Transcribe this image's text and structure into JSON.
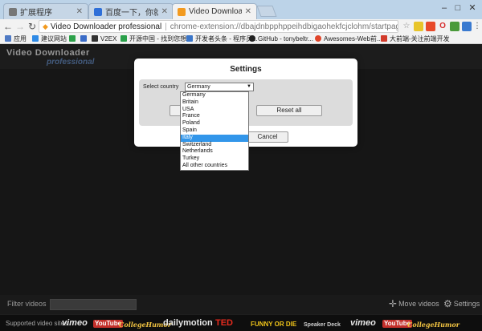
{
  "browser": {
    "tabs": [
      {
        "label": "扩展程序",
        "active": false,
        "icon": "puzzle-icon"
      },
      {
        "label": "百度一下，你就知道",
        "active": false,
        "icon": "baidu-icon"
      },
      {
        "label": "Video Downloader pro",
        "active": true,
        "icon": "video-downloader-icon"
      }
    ],
    "omnibox": {
      "ext_name": "Video Downloader professional",
      "url": "chrome-extension://dbajdnbpphppeihdbigaohekfcjclohm/startpage/index.html?optic"
    },
    "bookmarks": [
      {
        "label": "应用",
        "icon": "apps-icon"
      },
      {
        "label": "建议网站",
        "icon": "ie-icon"
      },
      {
        "label": "",
        "icon": "bookmark-green-icon"
      },
      {
        "label": "",
        "icon": "bookmark-blue-icon"
      },
      {
        "label": "V2EX",
        "icon": "v2ex-icon"
      },
      {
        "label": "开源中国 - 找到您想...",
        "icon": "oschina-icon"
      },
      {
        "label": "开发者头条 - 程序员...",
        "icon": "toutiao-icon"
      },
      {
        "label": "GitHub - tonybeltr...",
        "icon": "github-icon"
      },
      {
        "label": "Awesomes-Web前...",
        "icon": "awesomes-icon"
      },
      {
        "label": "大前端-关注前端开发",
        "icon": "daqianduan-icon"
      }
    ],
    "accent_color": "#3296ea"
  },
  "app": {
    "title_line1": "Video Downloader",
    "title_line2": "professional",
    "filter_label": "Filter videos",
    "filter_value": "",
    "move_videos_label": "Move videos",
    "settings_label": "Settings",
    "supported_label": "Supported video sites:",
    "sites": [
      "vimeo",
      "YouTube",
      "CollegeHumor",
      "dailymotion",
      "TED",
      "FUNNY OR DIE",
      "Speaker Deck",
      "vimeo",
      "YouTube",
      "CollegeHumor"
    ]
  },
  "settings_modal": {
    "title": "Settings",
    "country_label": "Select country",
    "selected_country": "Germany",
    "reset_all_label": "Reset all",
    "cancel_label": "Cancel",
    "country_options": [
      "Germany",
      "Britain",
      "USA",
      "France",
      "Poland",
      "Spain",
      "Italy",
      "Switzerland",
      "Netherlands",
      "Turkey",
      "All other countries"
    ],
    "highlighted_option": "Italy"
  }
}
